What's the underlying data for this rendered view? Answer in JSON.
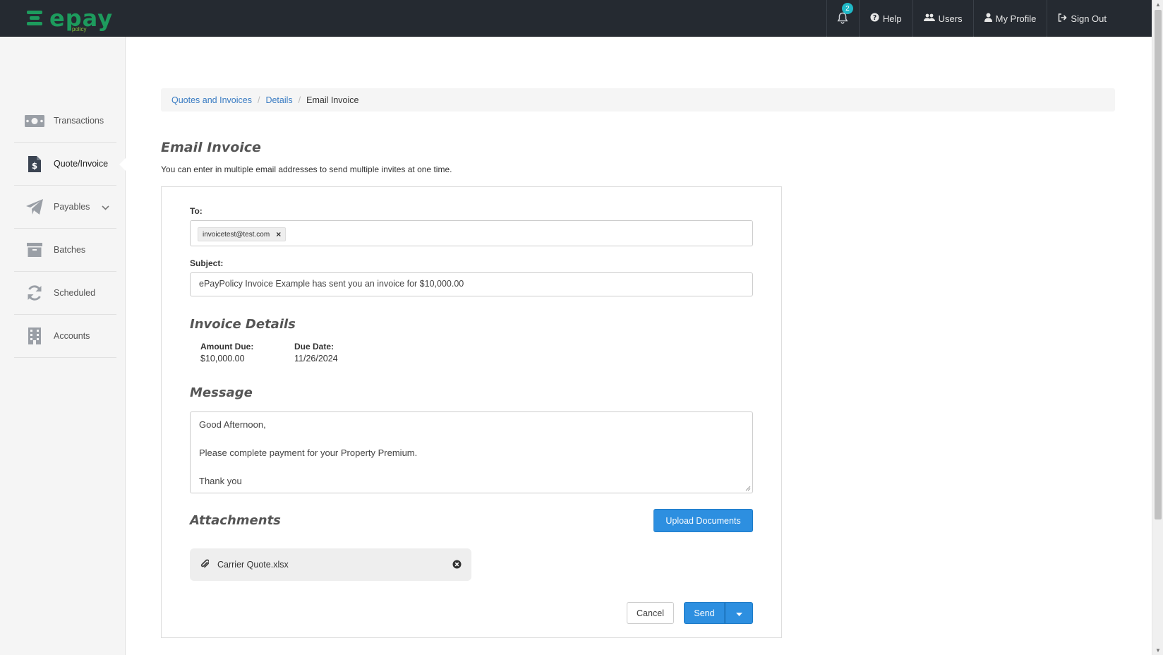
{
  "brand": {
    "name": "epay",
    "sub": "policy",
    "color": "#1d9b5d"
  },
  "topnav": {
    "notification_count": "2",
    "items": [
      {
        "label": "Help",
        "icon": "question-circle-icon"
      },
      {
        "label": "Users",
        "icon": "users-icon"
      },
      {
        "label": "My Profile",
        "icon": "user-icon"
      },
      {
        "label": "Sign Out",
        "icon": "sign-out-icon"
      }
    ]
  },
  "sidebar": {
    "items": [
      {
        "label": "Transactions",
        "icon": "money-bill-icon"
      },
      {
        "label": "Quote/Invoice",
        "icon": "invoice-dollar-icon",
        "active": true
      },
      {
        "label": "Payables",
        "icon": "paper-plane-icon",
        "has_dropdown": true
      },
      {
        "label": "Batches",
        "icon": "archive-box-icon"
      },
      {
        "label": "Scheduled",
        "icon": "sync-icon"
      },
      {
        "label": "Accounts",
        "icon": "building-icon"
      }
    ]
  },
  "breadcrumb": {
    "items": [
      "Quotes and Invoices",
      "Details"
    ],
    "current": "Email Invoice"
  },
  "page": {
    "title": "Email Invoice",
    "description": "You can enter in multiple email addresses to send multiple invites at one time."
  },
  "form": {
    "to_label": "To:",
    "to_tags": [
      "invoicetest@test.com"
    ],
    "subject_label": "Subject:",
    "subject_value": "ePayPolicy Invoice Example has sent you an invoice for $10,000.00",
    "invoice_details_title": "Invoice Details",
    "amount_due_label": "Amount Due:",
    "amount_due_value": "$10,000.00",
    "due_date_label": "Due Date:",
    "due_date_value": "11/26/2024",
    "message_title": "Message",
    "message_lines": [
      "Good Afternoon,",
      "Please complete payment for your Property Premium.",
      "Thank you"
    ],
    "attachments_title": "Attachments",
    "upload_label": "Upload Documents",
    "attachments": [
      "Carrier Quote.xlsx"
    ],
    "cancel_label": "Cancel",
    "send_label": "Send"
  },
  "colors": {
    "topbar": "#252a31",
    "primary": "#2d8fe0",
    "link": "#3a7cc3",
    "badge": "#1fb8c7"
  }
}
